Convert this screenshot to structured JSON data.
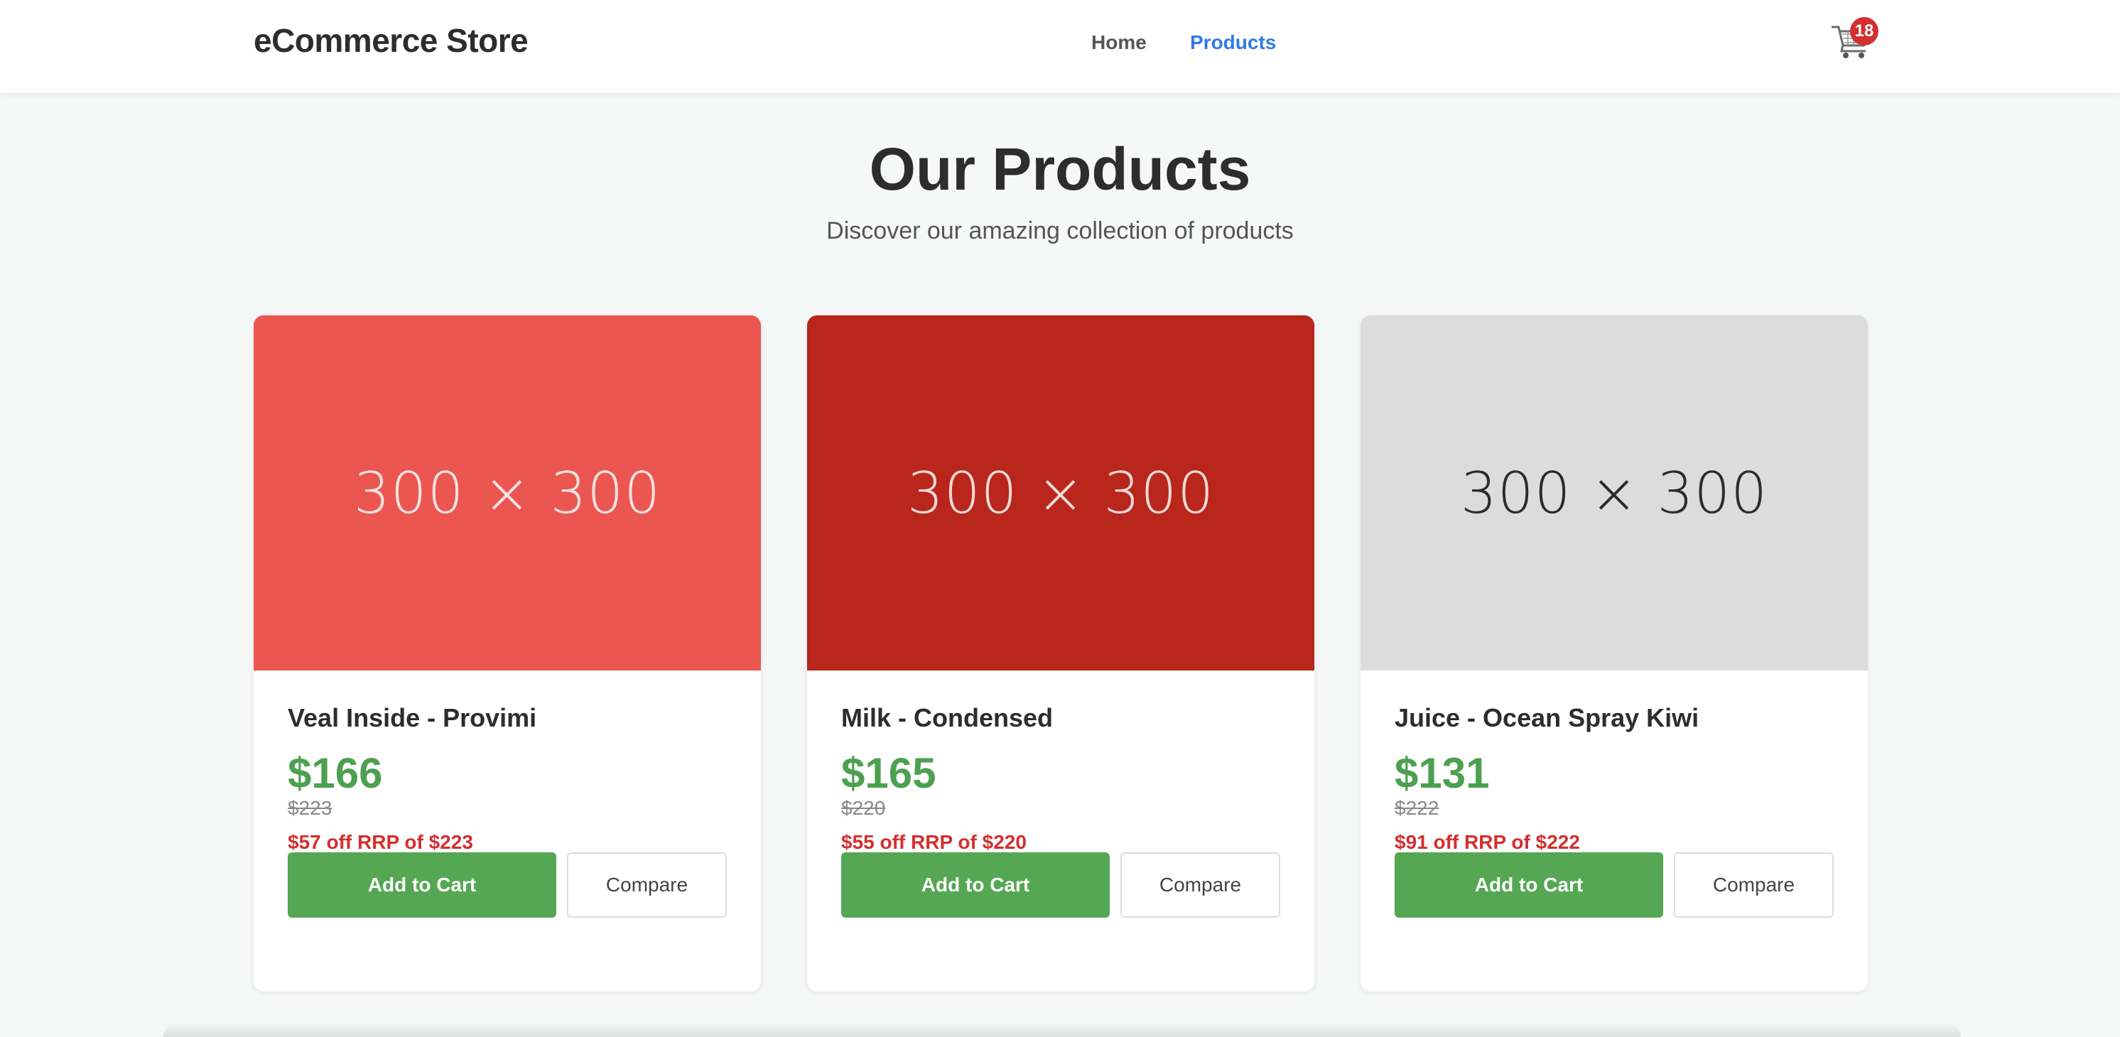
{
  "header": {
    "brand": "eCommerce Store",
    "nav": [
      {
        "label": "Home",
        "active": false
      },
      {
        "label": "Products",
        "active": true
      }
    ],
    "cart": {
      "icon": "cart-icon",
      "count": "18"
    }
  },
  "hero": {
    "title": "Our Products",
    "subtitle": "Discover our amazing collection of products"
  },
  "products": [
    {
      "image_text": "300 × 300",
      "image_bg": "#eb5651",
      "image_fg": "#f7e3e2",
      "name": "Veal Inside - Provimi",
      "price": "$166",
      "rrp": "$223",
      "saving": "$57 off RRP of $223",
      "add_label": "Add to Cart",
      "compare_label": "Compare"
    },
    {
      "image_text": "300 × 300",
      "image_bg": "#b9261b",
      "image_fg": "#f1d9d6",
      "name": "Milk - Condensed",
      "price": "$165",
      "rrp": "$220",
      "saving": "$55 off RRP of $220",
      "add_label": "Add to Cart",
      "compare_label": "Compare"
    },
    {
      "image_text": "300 × 300",
      "image_bg": "#dcdcdc",
      "image_fg": "#2b2b2b",
      "name": "Juice - Ocean Spray Kiwi",
      "price": "$131",
      "rrp": "$222",
      "saving": "$91 off RRP of $222",
      "add_label": "Add to Cart",
      "compare_label": "Compare"
    }
  ],
  "colors": {
    "accent_blue": "#2f7be6",
    "price_green": "#4ca04f",
    "button_green": "#55a754",
    "discount_red": "#d32f2f"
  }
}
